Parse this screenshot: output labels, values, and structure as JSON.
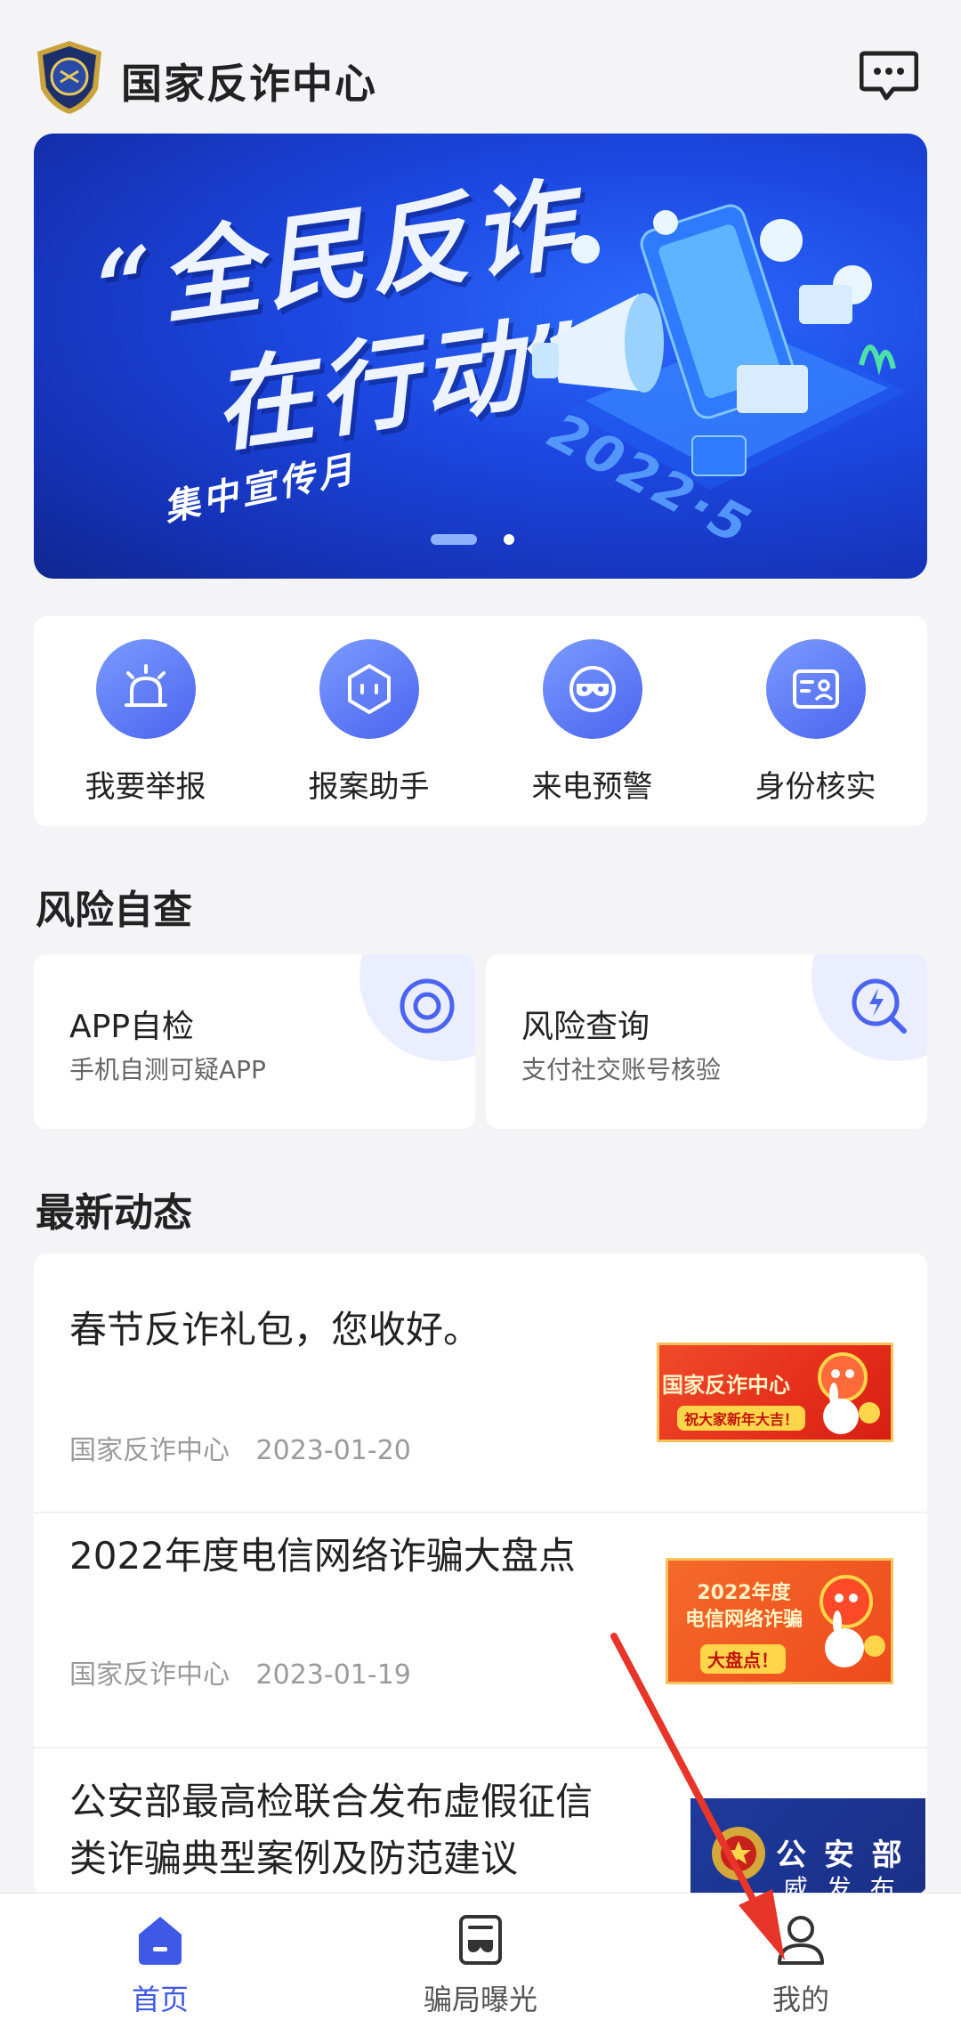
{
  "header": {
    "title": "国家反诈中心",
    "logo_icon": "police-badge-icon",
    "message_icon": "message-bubble-icon"
  },
  "banner": {
    "line1": "“全民反诈",
    "line2": "在行动”",
    "subtitle": "集中宣传月",
    "date": "2022·5",
    "slides": 2,
    "active_slide": 1
  },
  "actions": [
    {
      "label": "我要举报",
      "icon": "alarm-light-icon"
    },
    {
      "label": "报案助手",
      "icon": "hexagon-face-icon"
    },
    {
      "label": "来电预警",
      "icon": "mask-icon"
    },
    {
      "label": "身份核实",
      "icon": "id-card-icon"
    }
  ],
  "risk_section": {
    "title": "风险自查",
    "cards": [
      {
        "title": "APP自检",
        "subtitle": "手机自测可疑APP",
        "icon": "scan-shield-icon"
      },
      {
        "title": "风险查询",
        "subtitle": "支付社交账号核验",
        "icon": "search-lightning-icon"
      }
    ]
  },
  "news_section": {
    "title": "最新动态",
    "items": [
      {
        "title": "春节反诈礼包，您收好。",
        "source": "国家反诈中心",
        "date": "2023-01-20",
        "thumb_text": "国家反诈中心",
        "thumb_tag": "祝大家新年大吉！"
      },
      {
        "title": "2022年度电信网络诈骗大盘点",
        "source": "国家反诈中心",
        "date": "2023-01-19",
        "thumb_text": "2022年度\n电信网络诈骗",
        "thumb_tag": "大盘点！"
      },
      {
        "title_line1": "公安部最高检联合发布虚假征信",
        "title_line2": "类诈骗典型案例及防范建议",
        "thumb_text": "公 安 部",
        "thumb_sub": "威 发 布"
      }
    ]
  },
  "bottom_nav": [
    {
      "label": "首页",
      "icon": "home-icon",
      "active": true
    },
    {
      "label": "骗局曝光",
      "icon": "exposure-report-icon",
      "active": false
    },
    {
      "label": "我的",
      "icon": "user-profile-icon",
      "active": false
    }
  ],
  "colors": {
    "accent": "#3f59e6",
    "background": "#f4f4f6",
    "annotation_arrow": "#e8352a"
  }
}
